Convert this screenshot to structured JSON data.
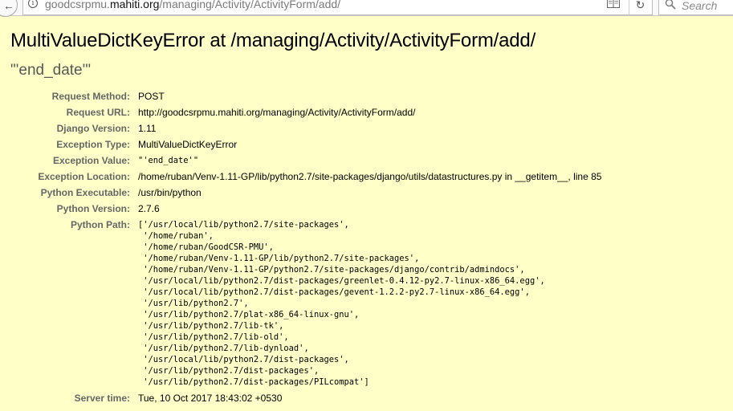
{
  "browser": {
    "url_prefix": "goodcsrpmu.",
    "url_domain": "mahiti.org",
    "url_path": "/managing/Activity/ActivityForm/add/",
    "search_placeholder": "Search",
    "back_glyph": "←",
    "reload_glyph": "↻",
    "info_glyph": "i",
    "icons": [
      "back-arrow-icon",
      "info-icon",
      "reader-view-icon",
      "reload-icon",
      "search-icon"
    ]
  },
  "error": {
    "title": "MultiValueDictKeyError at /managing/Activity/ActivityForm/add/",
    "exception_value": "\"'end_date'\""
  },
  "summary": [
    {
      "label": "Request Method:",
      "value": "POST"
    },
    {
      "label": "Request URL:",
      "value": "http://goodcsrpmu.mahiti.org/managing/Activity/ActivityForm/add/"
    },
    {
      "label": "Django Version:",
      "value": "1.11"
    },
    {
      "label": "Exception Type:",
      "value": "MultiValueDictKeyError"
    },
    {
      "label": "Exception Value:",
      "value": "\"'end_date'\""
    },
    {
      "label": "Exception Location:",
      "value": "/home/ruban/Venv-1.11-GP/lib/python2.7/site-packages/django/utils/datastructures.py in __getitem__, line 85"
    },
    {
      "label": "Python Executable:",
      "value": "/usr/bin/python"
    },
    {
      "label": "Python Version:",
      "value": "2.7.6"
    },
    {
      "label": "Python Path:",
      "value": ""
    },
    {
      "label": "Server time:",
      "value": "Tue, 10 Oct 2017 18:43:02 +0530"
    }
  ],
  "python_path": [
    "['/usr/local/lib/python2.7/site-packages',",
    " '/home/ruban',",
    " '/home/ruban/GoodCSR-PMU',",
    " '/home/ruban/Venv-1.11-GP/lib/python2.7/site-packages',",
    " '/home/ruban/Venv-1.11-GP/python2.7/site-packages/django/contrib/admindocs',",
    " '/usr/local/lib/python2.7/dist-packages/greenlet-0.4.12-py2.7-linux-x86_64.egg',",
    " '/usr/local/lib/python2.7/dist-packages/gevent-1.2.2-py2.7-linux-x86_64.egg',",
    " '/usr/lib/python2.7',",
    " '/usr/lib/python2.7/plat-x86_64-linux-gnu',",
    " '/usr/lib/python2.7/lib-tk',",
    " '/usr/lib/python2.7/lib-old',",
    " '/usr/lib/python2.7/lib-dynload',",
    " '/usr/local/lib/python2.7/dist-packages',",
    " '/usr/lib/python2.7/dist-packages',",
    " '/usr/lib/python2.7/dist-packages/PILcompat']"
  ]
}
